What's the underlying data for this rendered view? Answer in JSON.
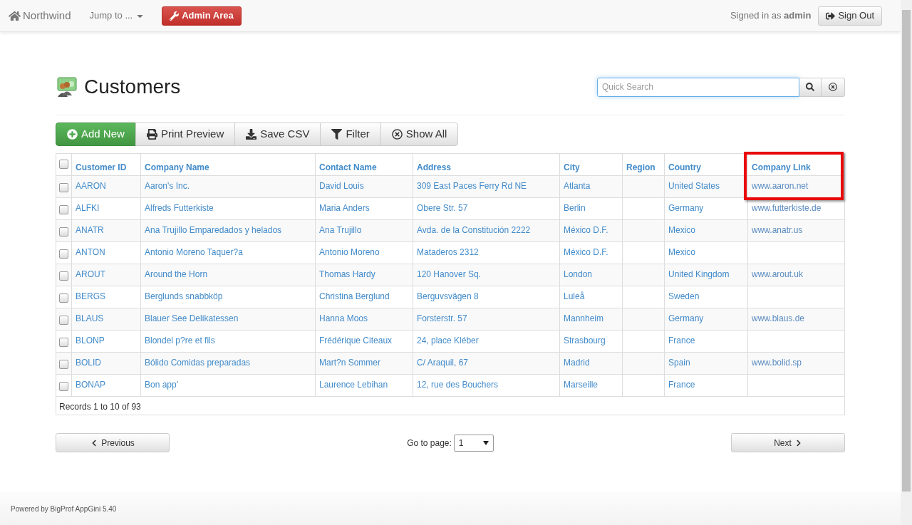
{
  "navbar": {
    "brand": "Northwind",
    "jump_menu": "Jump to ...",
    "admin_button": "Admin Area",
    "signed_in_prefix": "Signed in as",
    "username": "admin",
    "sign_out": "Sign Out"
  },
  "page": {
    "title": "Customers",
    "search": {
      "placeholder": "Quick Search"
    }
  },
  "toolbar": [
    {
      "label": "Add New",
      "kind": "add"
    },
    {
      "label": "Print Preview",
      "kind": "print"
    },
    {
      "label": "Save CSV",
      "kind": "download"
    },
    {
      "label": "Filter",
      "kind": "filter"
    },
    {
      "label": "Show All",
      "kind": "clear"
    }
  ],
  "table": {
    "select_all_checked": false,
    "columns": [
      {
        "label": "Customer ID",
        "highlighted": false
      },
      {
        "label": "Company Name",
        "highlighted": false
      },
      {
        "label": "Contact Name",
        "highlighted": false
      },
      {
        "label": "Address",
        "highlighted": false
      },
      {
        "label": "City",
        "highlighted": false
      },
      {
        "label": "Region",
        "highlighted": false
      },
      {
        "label": "Country",
        "highlighted": false
      },
      {
        "label": "Company Link",
        "highlighted": true
      }
    ],
    "rows": [
      {
        "checked": false,
        "cells": [
          "AARON",
          "Aaron's Inc.",
          "David Louis",
          "309 East Paces Ferry Rd NE",
          "Atlanta",
          "",
          "United States",
          "www.aaron.net"
        ]
      },
      {
        "checked": false,
        "cells": [
          "ALFKI",
          "Alfreds Futterkiste",
          "Maria Anders",
          "Obere Str. 57",
          "Berlin",
          "",
          "Germany",
          "www.futterkiste.de"
        ]
      },
      {
        "checked": false,
        "cells": [
          "ANATR",
          "Ana Trujillo Emparedados y helados",
          "Ana Trujillo",
          "Avda. de la Constitución 2222",
          "México D.F.",
          "",
          "Mexico",
          "www.anatr.us"
        ]
      },
      {
        "checked": false,
        "cells": [
          "ANTON",
          "Antonio Moreno Taquer?a",
          "Antonio Moreno",
          "Mataderos 2312",
          "México D.F.",
          "",
          "Mexico",
          ""
        ]
      },
      {
        "checked": false,
        "cells": [
          "AROUT",
          "Around the Horn",
          "Thomas Hardy",
          "120 Hanover Sq.",
          "London",
          "",
          "United Kingdom",
          "www.arout.uk"
        ]
      },
      {
        "checked": false,
        "cells": [
          "BERGS",
          "Berglunds snabbköp",
          "Christina Berglund",
          "Berguvsvägen 8",
          "Luleå",
          "",
          "Sweden",
          ""
        ]
      },
      {
        "checked": false,
        "cells": [
          "BLAUS",
          "Blauer See Delikatessen",
          "Hanna Moos",
          "Forsterstr. 57",
          "Mannheim",
          "",
          "Germany",
          "www.blaus.de"
        ]
      },
      {
        "checked": false,
        "cells": [
          "BLONP",
          "Blondel p?re et fils",
          "Frédérique Citeaux",
          "24, place Kléber",
          "Strasbourg",
          "",
          "France",
          ""
        ]
      },
      {
        "checked": false,
        "cells": [
          "BOLID",
          "Bólido Comidas preparadas",
          "Mart?n Sommer",
          "C/ Araquil, 67",
          "Madrid",
          "",
          "Spain",
          "www.bolid.sp"
        ]
      },
      {
        "checked": false,
        "cells": [
          "BONAP",
          "Bon app'",
          "Laurence Lebihan",
          "12, rue des Bouchers",
          "Marseille",
          "",
          "France",
          ""
        ]
      }
    ],
    "records": "Records 1 to 10 of 93"
  },
  "pagination": {
    "previous": "Previous",
    "goto_label": "Go to page:",
    "page": "1",
    "next": "Next"
  },
  "footer": "Powered by BigProf AppGini 5.40"
}
